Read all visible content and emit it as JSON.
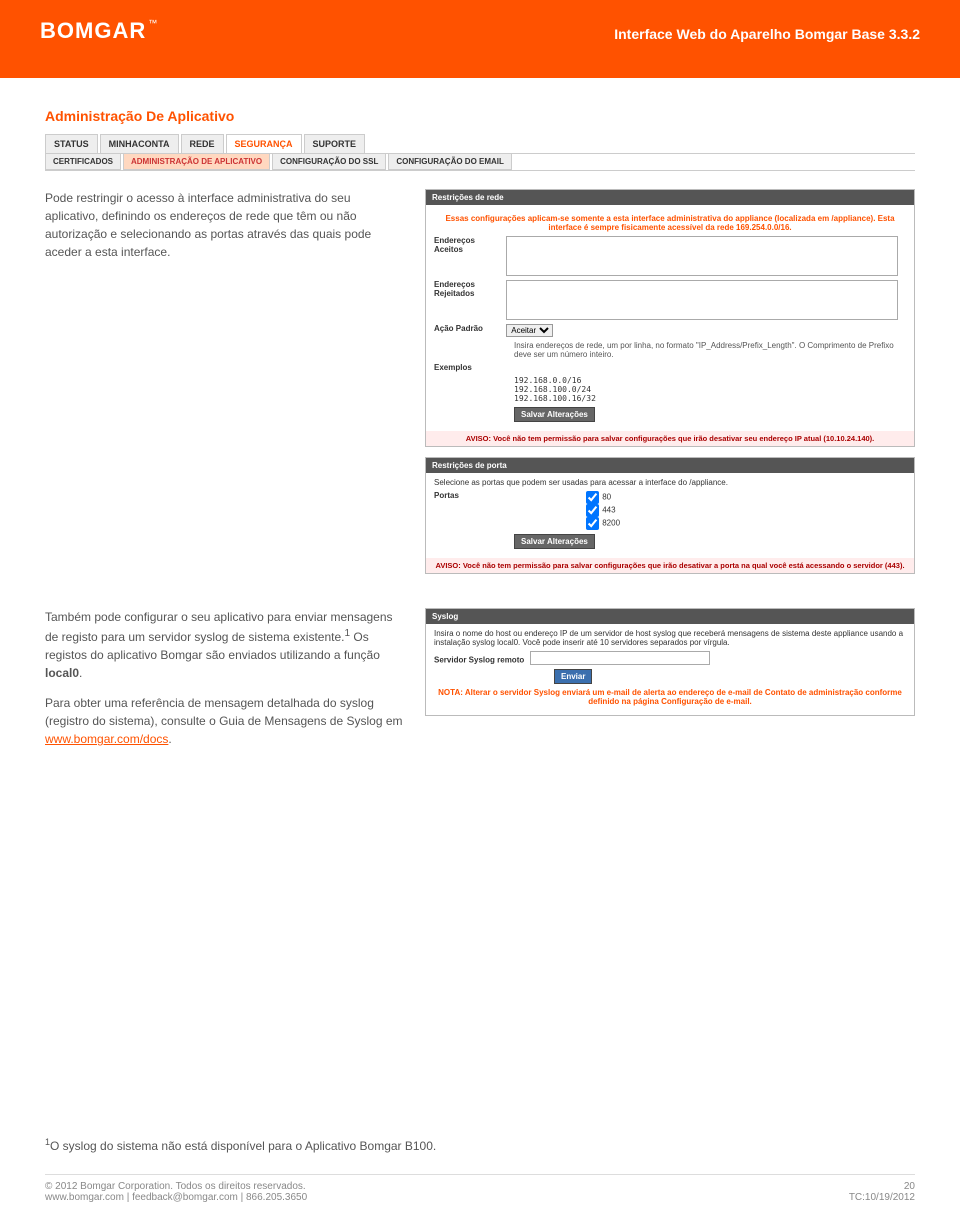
{
  "header": {
    "logo": "BOMGAR",
    "title": "Interface Web do Aparelho Bomgar Base 3.3.2"
  },
  "section_title": "Administração De Aplicativo",
  "tabs": {
    "items": [
      "STATUS",
      "MINHACONTA",
      "REDE",
      "SEGURANÇA",
      "SUPORTE"
    ],
    "sub": [
      "CERTIFICADOS",
      "ADMINISTRAÇÃO DE APLICATIVO",
      "CONFIGURAÇÃO DO SSL",
      "CONFIGURAÇÃO DO EMAIL"
    ]
  },
  "intro_paragraph": "Pode restringir o acesso à interface administrativa do seu aplicativo, definindo os endereços de rede que têm ou não autorização e selecionando as portas através das quais pode aceder a esta interface.",
  "network_panel": {
    "header": "Restrições de rede",
    "note1": "Essas configurações aplicam-se somente a esta interface administrativa do appliance (localizada em /appliance). Esta interface é sempre fisicamente acessível da rede 169.254.0.0/16.",
    "accepted_label": "Endereços Aceitos",
    "rejected_label": "Endereços Rejeitados",
    "default_action_label": "Ação Padrão",
    "default_action_value": "Aceitar",
    "hint": "Insira endereços de rede, um por linha, no formato \"IP_Address/Prefix_Length\". O Comprimento de Prefixo deve ser um número inteiro.",
    "examples_label": "Exemplos",
    "examples": "192.168.0.0/16\n192.168.100.0/24\n192.168.100.16/32",
    "save": "Salvar Alterações",
    "warn": "AVISO: Você não tem permissão para salvar configurações que irão desativar seu endereço IP atual (10.10.24.140)."
  },
  "port_panel": {
    "header": "Restrições de porta",
    "desc": "Selecione as portas que podem ser usadas para acessar a interface do /appliance.",
    "ports_label": "Portas",
    "ports": [
      "80",
      "443",
      "8200"
    ],
    "save": "Salvar Alterações",
    "warn": "AVISO: Você não tem permissão para salvar configurações que irão desativar a porta na qual você está acessando o servidor (443)."
  },
  "syslog_paragraph_1": "Também pode configurar o seu aplicativo para enviar mensagens de registo para um servidor syslog de sistema existente.",
  "syslog_paragraph_1_tail": " Os registos do aplicativo Bomgar são enviados utilizando a função ",
  "syslog_bold": "local0",
  "syslog_paragraph_2": "Para obter uma referência de mensagem detalhada do syslog (registro do sistema), consulte o Guia de Mensagens de Syslog em ",
  "syslog_link": "www.bomgar.com/docs",
  "syslog_panel": {
    "header": "Syslog",
    "desc": "Insira o nome do host ou endereço IP de um servidor de host syslog que receberá mensagens de sistema deste appliance usando a instalação syslog local0. Você pode inserir até 10 servidores separados por vírgula.",
    "server_label": "Servidor Syslog remoto",
    "send": "Enviar",
    "note": "NOTA: Alterar o servidor Syslog enviará um e-mail de alerta ao endereço de e-mail de Contato de administração conforme definido na página Configuração de e-mail."
  },
  "footnote": "O syslog do sistema não está disponível para o Aplicativo Bomgar B100.",
  "footer": {
    "copyright": "© 2012 Bomgar Corporation. Todos os direitos reservados.",
    "contact": "www.bomgar.com | feedback@bomgar.com | 866.205.3650",
    "page_num": "20",
    "tc": "TC:10/19/2012"
  }
}
